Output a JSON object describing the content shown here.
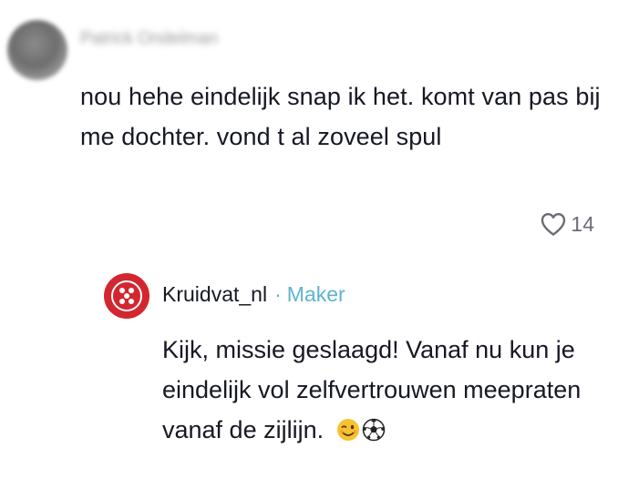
{
  "comment": {
    "username": "Patrick Ondelman",
    "text": "nou hehe eindelijk snap ik het. komt van pas bij me dochter. vond t al zoveel spul",
    "likes": "14",
    "like_icon": "heart-outline-icon"
  },
  "reply": {
    "username": "Kruidvat_nl",
    "separator": "·",
    "badge": "Maker",
    "text": "Kijk, missie geslaagd! Vanaf nu kun je eindelijk vol zelfvertrouwen meepraten vanaf de zijlijn.",
    "emojis": [
      "winking-face-icon",
      "soccer-ball-icon"
    ],
    "brand_color": "#d22730",
    "badge_color": "#5fb3cf"
  }
}
